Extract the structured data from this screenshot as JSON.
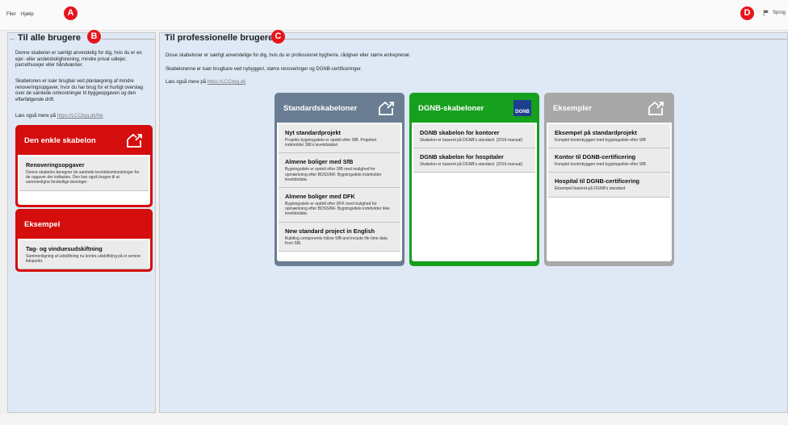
{
  "menu": {
    "file": "Filer",
    "help": "Hjælp",
    "language": "Sprog"
  },
  "markers": {
    "a": "A",
    "b": "B",
    "c": "C",
    "d": "D"
  },
  "left": {
    "title": "Til alle brugere",
    "para1": "Denne skabelon er særligt anvendelig for dig, hvis du er en ejer- eller andelsboligforening, mindre privat udlejer, parcelhusejer eller håndværker.",
    "para2": "Skabelonen er især brugbar ved planlægning af mindre renoveringsopgaver, hvor du har brug for et hurtigt overslag over de samlede omkostninger til byggeopgaven og den efterfølgende drift.",
    "read_more": "Læs også mere på",
    "link": "https://LCCbyg.dk/lite",
    "card1": {
      "title": "Den enkle skabelon",
      "items": [
        {
          "title": "Renoveringsopgaver",
          "desc": "Denne skabelon beregner de samlede levetidsomkostninger for de opgaver der indtastes. Den kan også bruges til at sammenligne forskellige løsninger"
        }
      ]
    },
    "card2": {
      "title": "Eksempel",
      "items": [
        {
          "title": "Tag- og vinduesudskiftning",
          "desc": "Sammenligning af udskiftning nu kontra udskiftning på et senere tidspunkt."
        }
      ]
    }
  },
  "right": {
    "title": "Til professionelle brugere",
    "para1": "Disse skabeloner er særligt anvendelige for dig, hvis du er professionel bygherre, rådgiver eller større entreprenør.",
    "para2": "Skabelonerne er især brugbare ved nybyggeri, større renoveringer og DGNB-certificeringer.",
    "read_more": "Læs også mere på",
    "link": "https://LCCbyg.dk",
    "standard": {
      "title": "Standardskabeloner",
      "items": [
        {
          "title": "Nyt standardprojekt",
          "desc": "Projekts bygningsdele er opdelt efter SfB. Projektet indeholder SBi's levetidstabel"
        },
        {
          "title": "Almene boliger med SfB",
          "desc": "Bygningsdele er opdelt efter SfB med mulighed for opmærkning efter BOSSINF. Bygningsdele indeholder levetidsdata."
        },
        {
          "title": "Almene boliger med DFK",
          "desc": "Bygningsdele er opdelt efter DFK med mulighed for opmærkning efter BOSSINF. Bygningsdele indeholder ikke levetidsdata."
        },
        {
          "title": "New standard project in English",
          "desc": "Building components follow SfB and include life time data from SBi."
        }
      ]
    },
    "dgnb": {
      "title": "DGNB-skabeloner",
      "logo": "DGNB",
      "items": [
        {
          "title": "DGNB skabelon for kontorer",
          "desc": "Skabelon er baseret på DGNB's standard. (2016-manual)"
        },
        {
          "title": "DGNB skabelon for hospitaler",
          "desc": "Skabelon er baseret på DGNB's standard. (2016-manual)"
        }
      ]
    },
    "examples": {
      "title": "Eksempler",
      "items": [
        {
          "title": "Eksempel på standardprojekt",
          "desc": "Komplet kontorbyggeri med bygningsdele efter SfB"
        },
        {
          "title": "Kontor til DGNB-certificering",
          "desc": "Komplet kontorbyggeri med bygningsdele efter SfB"
        },
        {
          "title": "Hospital til DGNB-certificering",
          "desc": "Eksempel baseret på DGNB's standard."
        }
      ]
    }
  },
  "colors": {
    "red": "#d40d0d",
    "slate": "#6a7d93",
    "green": "#16a01e",
    "grey": "#a8a8a8",
    "marker": "#e8141c",
    "panel": "#dfe9f5"
  }
}
